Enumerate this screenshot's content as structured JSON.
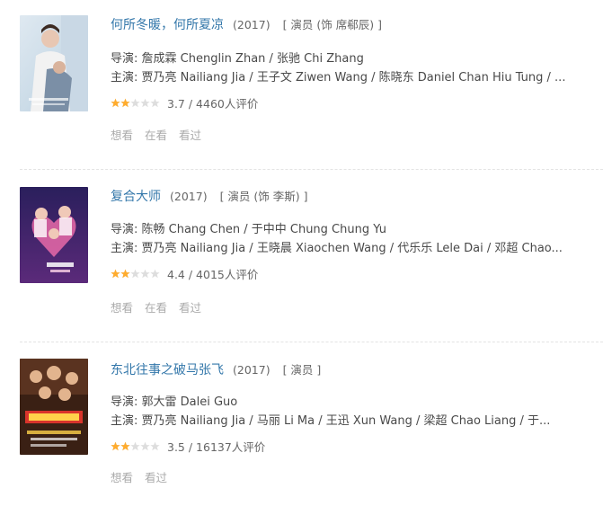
{
  "movies": [
    {
      "title": "何所冬暖，何所夏凉",
      "year": "(2017)",
      "role": "[ 演员 (饰 席郗辰) ]",
      "director": "导演: 詹成霖 Chenglin Zhan / 张驰 Chi Zhang",
      "cast": "主演: 贾乃亮 Nailiang Jia / 王子文 Ziwen Wang / 陈晓东 Daniel Chan Hiu Tung / ...",
      "score": 3.7,
      "rating_text": "3.7 / 4460人评价",
      "actions": [
        "想看",
        "在看",
        "看过"
      ]
    },
    {
      "title": "复合大师",
      "year": "(2017)",
      "role": "[ 演员 (饰 李斯) ]",
      "director": "导演: 陈畅 Chang Chen / 于中中 Chung Chung Yu",
      "cast": "主演: 贾乃亮 Nailiang Jia / 王晓晨 Xiaochen Wang / 代乐乐 Lele Dai / 邓超 Chao...",
      "score": 4.4,
      "rating_text": "4.4 / 4015人评价",
      "actions": [
        "想看",
        "在看",
        "看过"
      ]
    },
    {
      "title": "东北往事之破马张飞",
      "year": "(2017)",
      "role": "[ 演员 ]",
      "director": "导演: 郭大雷 Dalei Guo",
      "cast": "主演: 贾乃亮 Nailiang Jia / 马丽 Li Ma / 王迅 Xun Wang / 梁超 Chao Liang / 于...",
      "score": 3.5,
      "rating_text": "3.5 / 16137人评价",
      "actions": [
        "想看",
        "看过"
      ]
    }
  ],
  "colors": {
    "title": "#3377aa",
    "star_filled": "#ffac2d",
    "star_empty": "#dddddd",
    "action": "#aaaaaa"
  }
}
